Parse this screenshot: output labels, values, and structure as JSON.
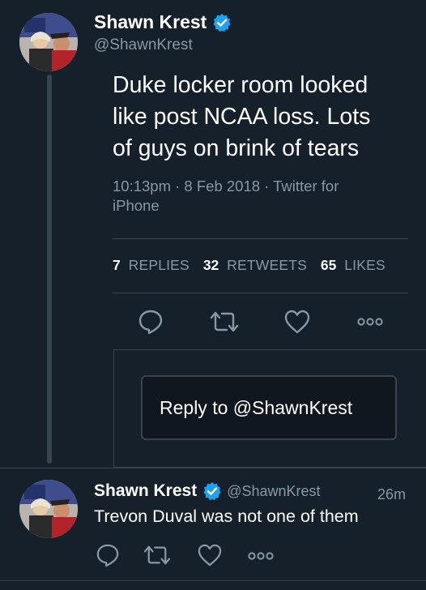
{
  "tweet": {
    "author_name": "Shawn Krest",
    "author_handle": "@ShawnKrest",
    "text_lines": [
      "Duke locker room looked",
      "like post NCAA loss. Lots",
      "of guys on brink of tears"
    ],
    "meta_lines": [
      "10:13pm · 8 Feb 2018 · Twitter for",
      "iPhone"
    ],
    "stats": {
      "replies_count": "7",
      "replies_label": "REPLIES",
      "retweets_count": "32",
      "retweets_label": "RETWEETS",
      "likes_count": "65",
      "likes_label": "LIKES"
    }
  },
  "reply_prompt": "Reply to @ShawnKrest",
  "reply_tweet": {
    "author_name": "Shawn Krest",
    "author_handle": "@ShawnKrest",
    "time": "26m",
    "text": "Trevon Duval was not one of them"
  },
  "icons": {
    "reply": "reply-icon",
    "retweet": "retweet-icon",
    "like": "heart-icon",
    "more": "more-icon",
    "verified": "verified-badge-icon"
  },
  "colors": {
    "background": "#15202b",
    "secondary_text": "#8899a6",
    "border": "#38444d",
    "verified_blue": "#1da1f2"
  }
}
